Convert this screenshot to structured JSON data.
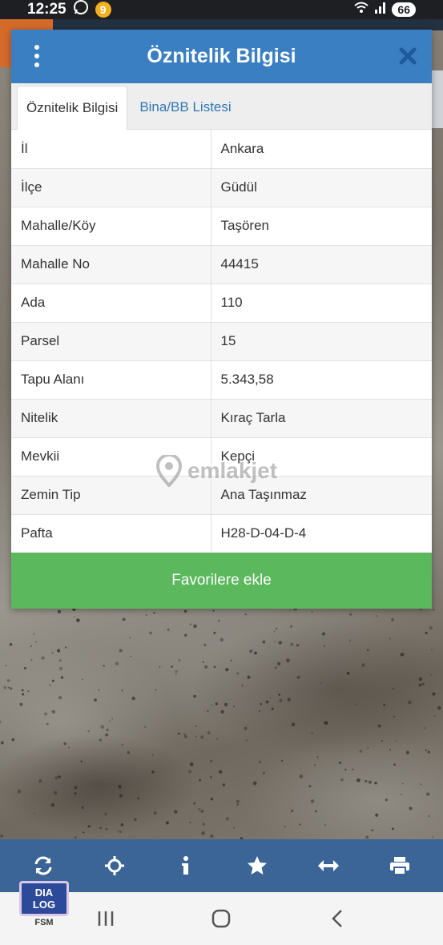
{
  "status_bar": {
    "time": "12:25",
    "battery": "66"
  },
  "dialog": {
    "title": "Öznitelik Bilgisi",
    "tabs": [
      {
        "label": "Öznitelik Bilgisi",
        "active": true
      },
      {
        "label": "Bina/BB Listesi",
        "active": false
      }
    ],
    "rows": [
      {
        "key": "İl",
        "value": "Ankara"
      },
      {
        "key": "İlçe",
        "value": "Güdül"
      },
      {
        "key": "Mahalle/Köy",
        "value": "Taşören"
      },
      {
        "key": "Mahalle No",
        "value": "44415"
      },
      {
        "key": "Ada",
        "value": "110"
      },
      {
        "key": "Parsel",
        "value": "15"
      },
      {
        "key": "Tapu Alanı",
        "value": "5.343,58"
      },
      {
        "key": "Nitelik",
        "value": "Kıraç Tarla"
      },
      {
        "key": "Mevkii",
        "value": "Kepçi"
      },
      {
        "key": "Zemin Tip",
        "value": "Ana Taşınmaz"
      },
      {
        "key": "Pafta",
        "value": "H28-D-04-D-4"
      }
    ],
    "favorite_button": "Favorilere ekle"
  },
  "watermark": "emlakjet",
  "toolbar": {
    "icons": [
      "refresh-icon",
      "locate-icon",
      "info-icon",
      "star-icon",
      "measure-icon",
      "print-icon"
    ]
  },
  "logo": {
    "box_line1": "DIA",
    "box_line2": "LOG",
    "caption": "FSM"
  },
  "colors": {
    "header_blue": "#3a7fc1",
    "toolbar_blue": "#3c6597",
    "favorite_green": "#5cb85c",
    "link_blue": "#2f76b5"
  }
}
